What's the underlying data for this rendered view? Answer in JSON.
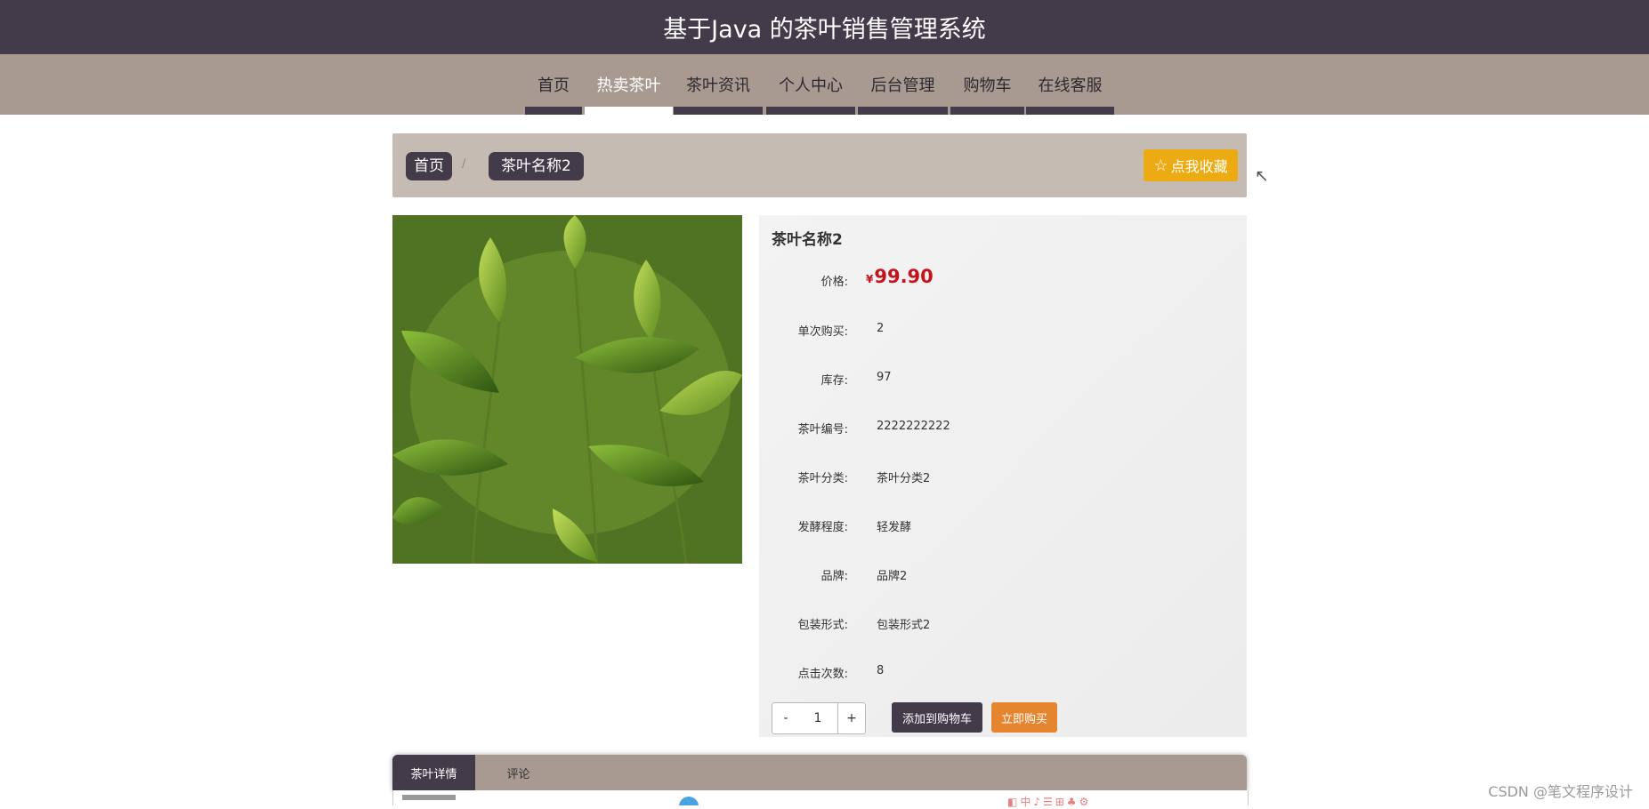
{
  "header": {
    "title": "基于Java 的茶叶销售管理系统"
  },
  "nav": {
    "items": [
      {
        "label": "首页"
      },
      {
        "label": "热卖茶叶"
      },
      {
        "label": "茶叶资讯"
      },
      {
        "label": "个人中心"
      },
      {
        "label": "后台管理"
      },
      {
        "label": "购物车"
      },
      {
        "label": "在线客服"
      }
    ],
    "active": "热卖茶叶"
  },
  "breadcrumb": {
    "home": "首页",
    "separator": "/",
    "current": "茶叶名称2"
  },
  "favorite_button": {
    "label": "点我收藏",
    "icon": "star-icon"
  },
  "product": {
    "name": "茶叶名称2",
    "price_label": "价格:",
    "price_currency": "¥",
    "price": "99.90",
    "fields": [
      {
        "label": "单次购买:",
        "value": "2"
      },
      {
        "label": "库存:",
        "value": "97"
      },
      {
        "label": "茶叶编号:",
        "value": "2222222222"
      },
      {
        "label": "茶叶分类:",
        "value": "茶叶分类2"
      },
      {
        "label": "发酵程度:",
        "value": "轻发酵"
      },
      {
        "label": "品牌:",
        "value": "品牌2"
      },
      {
        "label": "包装形式:",
        "value": "包装形式2"
      },
      {
        "label": "点击次数:",
        "value": "8"
      }
    ]
  },
  "quantity": {
    "minus": "-",
    "value": "1",
    "plus": "+"
  },
  "actions": {
    "add_to_cart": "添加到购物车",
    "buy_now": "立即购买"
  },
  "tabs": [
    {
      "label": "茶叶详情"
    },
    {
      "label": "评论"
    }
  ],
  "watermark": "CSDN @笔文程序设计",
  "colors": {
    "header_bg": "#433b4a",
    "nav_bg": "#a89a90",
    "breadcrumb_bg": "#c5bbb2",
    "favorite": "#ecab13",
    "price": "#c5131c",
    "buy_now": "#e58530"
  }
}
